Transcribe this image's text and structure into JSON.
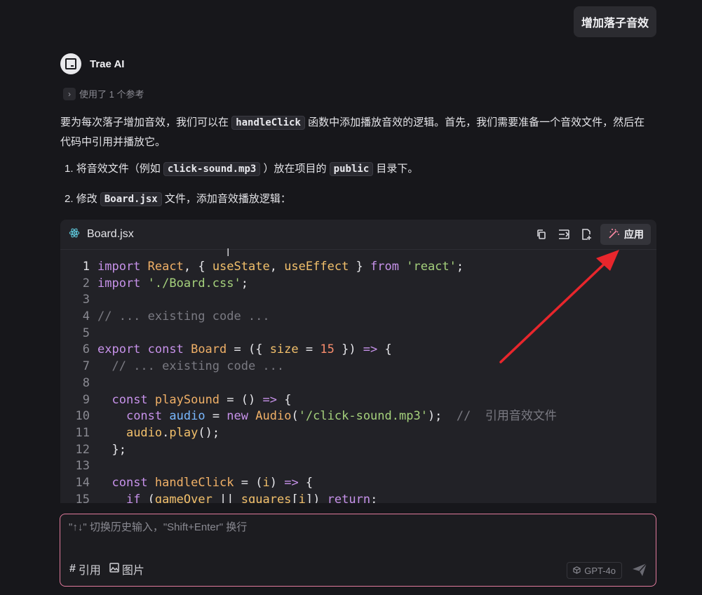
{
  "user_message": "增加落子音效",
  "assistant": {
    "name": "Trae AI",
    "refs_label": "使用了 1 个参考",
    "intro_a": "要为每次落子增加音效，我们可以在",
    "intro_code": "handleClick",
    "intro_b": "函数中添加播放音效的逻辑。首先，我们需要准备一个音效文件，然后在代码中引用并播放它。",
    "step1_num": "1.",
    "step1_a": "将音效文件（例如",
    "step1_code1": "click-sound.mp3",
    "step1_b": "）放在项目的",
    "step1_code2": "public",
    "step1_c": "目录下。",
    "step2_num": "2.",
    "step2_a": "修改",
    "step2_code": "Board.jsx",
    "step2_b": "文件，添加音效播放逻辑："
  },
  "code_block": {
    "filename": "Board.jsx",
    "apply_label": "应用",
    "line_numbers": [
      "1",
      "2",
      "3",
      "4",
      "5",
      "6",
      "7",
      "8",
      "9",
      "10",
      "11",
      "12",
      "13",
      "14",
      "15"
    ],
    "comment_existing": "// ... existing code ...",
    "comment_sound": "//  引用音效文件"
  },
  "input": {
    "placeholder": "\"↑↓\" 切换历史输入，\"Shift+Enter\" 换行",
    "ref_label": "引用",
    "image_label": "图片",
    "model": "GPT-4o"
  },
  "icons": {
    "file": "react-icon",
    "copy": "copy-icon",
    "insert": "insert-icon",
    "new_file": "new-file-icon",
    "apply": "magic-wand-icon",
    "send": "send-icon"
  },
  "colors": {
    "accent_arrow": "#e8262c",
    "input_border": "#e07a9c"
  }
}
